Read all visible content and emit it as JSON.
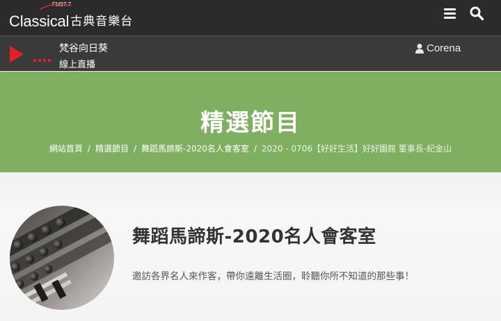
{
  "brand": {
    "logo_en": "Classical",
    "logo_fm": "FM97.7",
    "logo_zh": "古典音樂台"
  },
  "icons": {
    "menu": "hamburger-menu-icon",
    "search": "search-icon",
    "play": "play-icon",
    "user": "user-icon"
  },
  "colors": {
    "topbar": "#2b2b2b",
    "player_bar": "#3a3a3a",
    "accent_red": "#e0202a",
    "hero_green": "#7fb062"
  },
  "player": {
    "now_playing": "梵谷向日葵",
    "live_label": "線上直播"
  },
  "user": {
    "name": "Corena"
  },
  "hero": {
    "title": "精選節目"
  },
  "breadcrumb": {
    "items": [
      "網站首頁",
      "精選節目",
      "舞蹈馬諦斯-2020名人會客室",
      "2020 - 0706【好好生活】好好園館 董事長-紀金山"
    ],
    "separator": "/"
  },
  "program": {
    "title": "舞蹈馬諦斯-2020名人會客室",
    "description": "邀訪各界名人來作客，帶你遠離生活圈，聆聽你所不知道的那些事！"
  }
}
